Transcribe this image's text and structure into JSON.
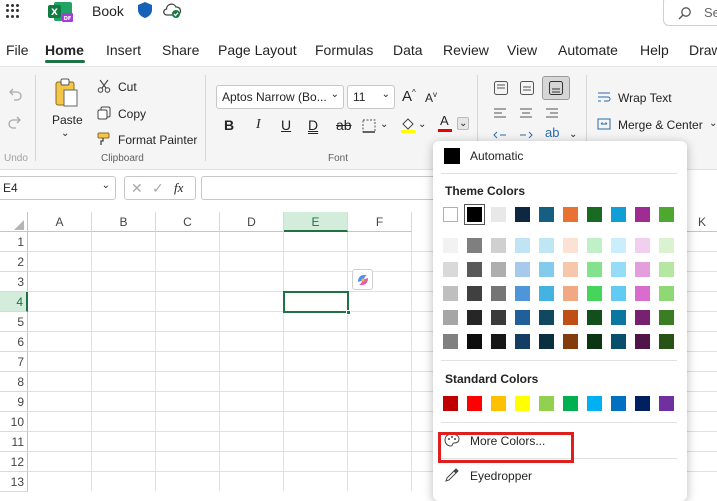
{
  "app": {
    "title": "Book",
    "search_partial": "Se"
  },
  "tabs": [
    "File",
    "Home",
    "Insert",
    "Share",
    "Page Layout",
    "Formulas",
    "Data",
    "Review",
    "View",
    "Automate",
    "Help",
    "Draw"
  ],
  "undo_group": {
    "label": "Undo"
  },
  "clipboard": {
    "paste": "Paste",
    "cut": "Cut",
    "copy": "Copy",
    "format_painter": "Format Painter",
    "group": "Clipboard"
  },
  "font": {
    "name": "Aptos Narrow (Bo...",
    "size": "11",
    "group": "Font"
  },
  "alignment": {
    "wrap_text": "Wrap Text",
    "merge_center": "Merge & Center"
  },
  "formula_bar": {
    "name_box": "E4",
    "fx": "fx"
  },
  "sheet": {
    "columns": [
      "A",
      "B",
      "C",
      "D",
      "E",
      "F"
    ],
    "col_k": "K",
    "rows": [
      "1",
      "2",
      "3",
      "4",
      "5",
      "6",
      "7",
      "8",
      "9",
      "10",
      "11",
      "12",
      "13"
    ],
    "selected_cell": "E4"
  },
  "color_menu": {
    "automatic": "Automatic",
    "theme_title": "Theme Colors",
    "standard_title": "Standard Colors",
    "more_colors": "More Colors...",
    "eyedropper": "Eyedropper",
    "theme_top": [
      "#ffffff",
      "#000000",
      "#e8e8e8",
      "#0e2841",
      "#156082",
      "#e97132",
      "#196b24",
      "#0f9ed5",
      "#a02b93",
      "#4ea72e"
    ],
    "theme_shades": [
      [
        "#f2f2f2",
        "#7f7f7f",
        "#d0d0d0",
        "#c1e4f5",
        "#c0e6f5",
        "#fbe2d5",
        "#c1f0c8",
        "#caeefb",
        "#f2ceef",
        "#daf2d0"
      ],
      [
        "#d9d9d9",
        "#595959",
        "#aeaeae",
        "#a6c9ec",
        "#83cbeb",
        "#f7c7ac",
        "#83e28e",
        "#95dcf7",
        "#e59edd",
        "#b5e6a2"
      ],
      [
        "#bfbfbf",
        "#404040",
        "#757575",
        "#4e95d9",
        "#44b3e1",
        "#f1a983",
        "#47d45a",
        "#61cbf4",
        "#d86dcd",
        "#8ed973"
      ],
      [
        "#a6a6a6",
        "#262626",
        "#3a3a3a",
        "#215f9a",
        "#104862",
        "#c04f15",
        "#124f1a",
        "#0b76a0",
        "#782170",
        "#3b7d23"
      ],
      [
        "#808080",
        "#0d0d0d",
        "#171717",
        "#153d64",
        "#0a303f",
        "#833c0c",
        "#0c3512",
        "#074f6a",
        "#4f1548",
        "#275317"
      ]
    ],
    "standard": [
      "#c00000",
      "#ff0000",
      "#ffc000",
      "#ffff00",
      "#92d050",
      "#00b050",
      "#00b0f0",
      "#0070c0",
      "#002060",
      "#7030a0"
    ]
  }
}
